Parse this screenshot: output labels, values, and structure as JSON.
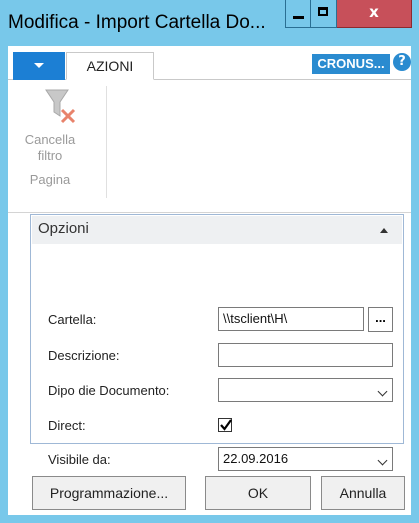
{
  "window": {
    "title": "Modifica - Import Cartella Do...",
    "close_label": "x"
  },
  "tabbar": {
    "active_tab": "AZIONI",
    "company": "CRONUS...",
    "help_label": "?"
  },
  "ribbon": {
    "clear_filter_label_1": "Cancella",
    "clear_filter_label_2": "filtro",
    "group_name": "Pagina"
  },
  "options": {
    "header": "Opzioni",
    "fields": {
      "cartella": {
        "label": "Cartella:",
        "value": "\\\\tsclient\\H\\"
      },
      "descrizione": {
        "label": "Descrizione:",
        "value": ""
      },
      "tipo_documento": {
        "label": "Dipo die Documento:",
        "value": ""
      },
      "direct": {
        "label": "Direct:",
        "checked": true
      },
      "visibile_da": {
        "label": "Visibile da:",
        "value": "22.09.2016"
      }
    },
    "lookup_label": "..."
  },
  "footer": {
    "schedule_label": "Programmazione...",
    "ok_label": "OK",
    "cancel_label": "Annulla"
  },
  "colors": {
    "titlebar": "#78c8ea",
    "accent": "#1c7fd4",
    "close_button": "#c7505a"
  }
}
